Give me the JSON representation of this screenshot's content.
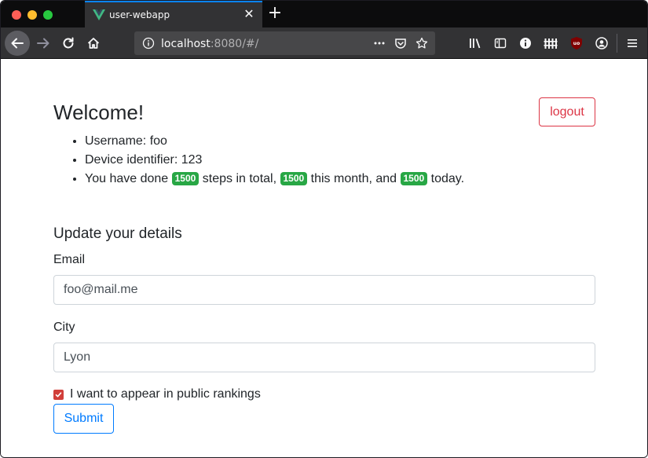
{
  "browser": {
    "tab_title": "user-webapp",
    "url_host": "localhost",
    "url_rest": ":8080/#/",
    "tab_close": "✕",
    "new_tab": "+"
  },
  "page": {
    "heading": "Welcome!",
    "logout_label": "logout",
    "username_label": "Username: foo",
    "device_label": "Device identifier: 123",
    "steps": {
      "prefix": "You have done ",
      "total": "1500",
      "mid1": " steps in total, ",
      "month": "1500",
      "mid2": " this month, and ",
      "today": "1500",
      "suffix": " today."
    },
    "section_title": "Update your details",
    "email_label": "Email",
    "email_value": "foo@mail.me",
    "city_label": "City",
    "city_value": "Lyon",
    "rankings_label": "I want to appear in public rankings",
    "rankings_checked": true,
    "submit_label": "Submit"
  },
  "colors": {
    "badge": "#28a745",
    "logout": "#dc3545",
    "submit": "#007bff",
    "tab_accent": "#0a84ff"
  }
}
